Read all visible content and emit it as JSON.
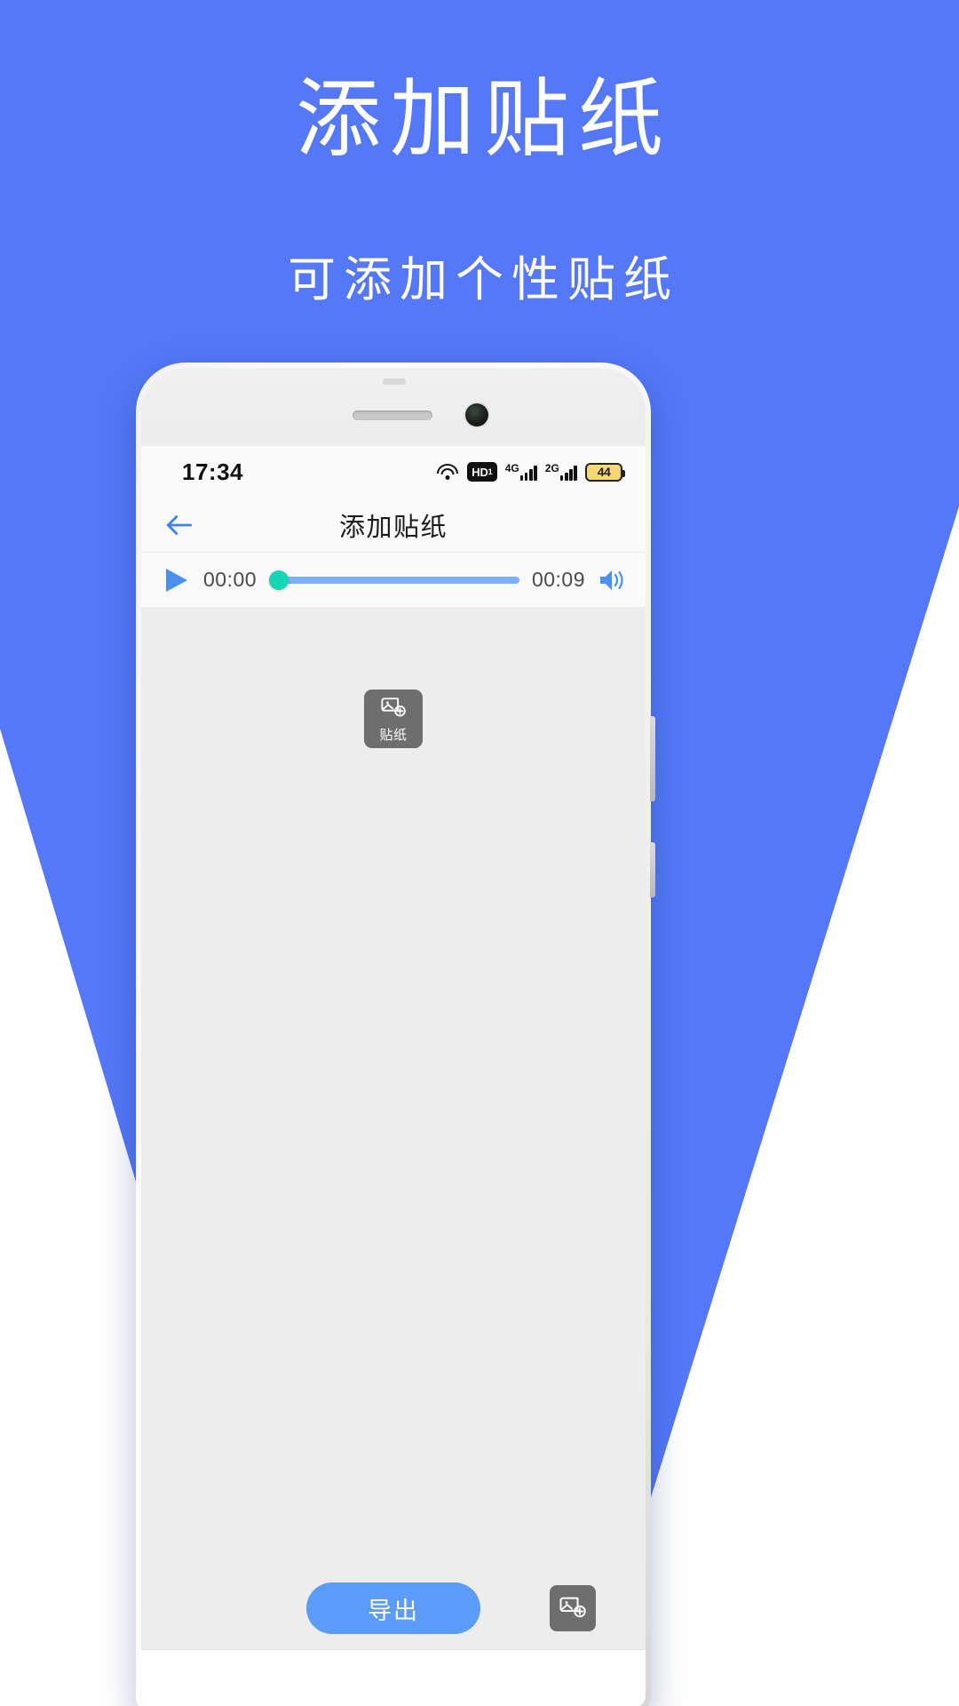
{
  "promo": {
    "title": "添加贴纸",
    "subtitle": "可添加个性贴纸",
    "background_color": "#5478f8",
    "text_color": "#ffffff"
  },
  "phone": {
    "statusbar": {
      "clock": "17:34",
      "wifi_icon": "wifi-icon",
      "hd_label": "HD",
      "hd_sub": "1",
      "sim1_network": "4G",
      "sim2_network": "2G",
      "battery_level": "44"
    },
    "appbar": {
      "back_icon": "back-arrow-icon",
      "title": "添加贴纸",
      "accent_color": "#3b82f6"
    },
    "player": {
      "play_icon": "play-icon",
      "current_time": "00:00",
      "total_time": "00:09",
      "volume_icon": "volume-icon",
      "progress_percent": 0,
      "thumb_color": "#16d6b4",
      "track_color": "#7cb0f7"
    },
    "editor": {
      "sticker_tool_label": "贴纸",
      "sticker_tool_icon": "sticker-add-icon",
      "export_label": "导出",
      "export_color": "#5b9cf8",
      "sticker_button_icon": "sticker-add-icon"
    }
  }
}
